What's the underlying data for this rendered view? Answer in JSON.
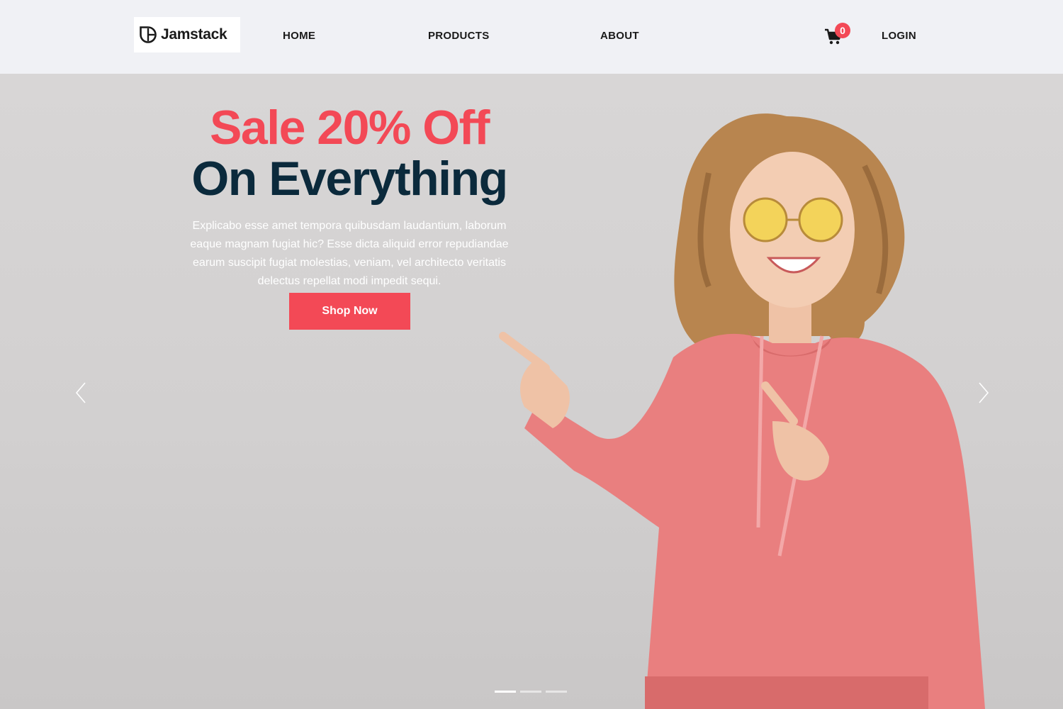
{
  "brand": {
    "name": "Jamstack"
  },
  "nav": {
    "home": "HOME",
    "products": "PRODUCTS",
    "about": "ABOUT",
    "login": "LOGIN"
  },
  "cart": {
    "count": "0",
    "icon": "cart-icon"
  },
  "hero": {
    "headline_line1": "Sale 20% Off",
    "headline_line2": "On Everything",
    "description": "Explicabo esse amet tempora quibusdam laudantium, laborum eaque magnam fugiat hic? Esse dicta aliquid error repudiandae earum suscipit fugiat molestias, veniam, vel architecto veritatis delectus repellat modi impedit sequi.",
    "cta_label": "Shop Now"
  },
  "carousel": {
    "slides": 3,
    "active_index": 0
  },
  "colors": {
    "accent": "#f34956",
    "headline_dark": "#0b2a3c",
    "header_bg": "#f0f1f5",
    "hoodie": "#e97f7f"
  }
}
